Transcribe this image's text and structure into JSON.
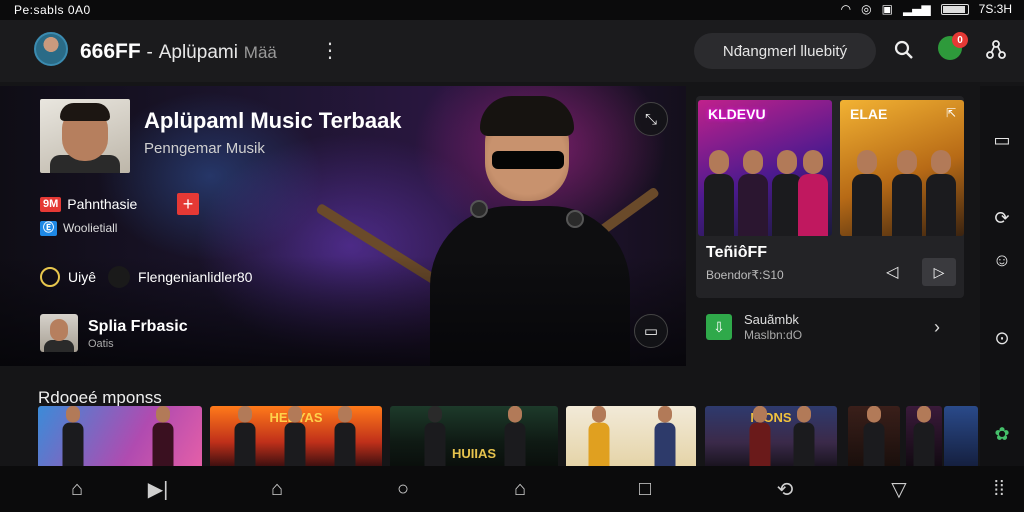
{
  "status_bar": {
    "left_text": "Pe:sabls 0A0",
    "time": "7S:3H"
  },
  "app_bar": {
    "brand": "666FF",
    "separator": "-",
    "app_name": "Aplüpami",
    "app_suffix": "Mää",
    "search_chip": "Nđangmerl lluebitý",
    "notification_count": "0"
  },
  "hero": {
    "title": "Aplüpaml Music Terbaak",
    "subtitle": "Penngemar Musik",
    "tag1": "9M",
    "tag1_text": "Pahnthasie",
    "tag2": "Ⓔ",
    "tag2_text": "Woolietiall",
    "meta_label": "Uiyê",
    "meta_text": "Flengenianlidler80",
    "artist_name": "Splia Frbasic",
    "artist_sub": "Oatis"
  },
  "right_panel": {
    "card1_title": "KLDEVU",
    "card2_title": "ELAE",
    "title": "TeñiôFF",
    "subtitle": "Boendor₹:S10",
    "download_title": "Sauãmbk",
    "download_sub": "Maslbn:dO"
  },
  "shelf": {
    "title": "Rdooeé mponss",
    "tiles": [
      {
        "title": ""
      },
      {
        "title": "HEDYAS"
      },
      {
        "title": "HUIIAS"
      },
      {
        "title": ""
      },
      {
        "title": "NIONS"
      },
      {
        "title": ""
      },
      {
        "title": ""
      }
    ]
  },
  "colors": {
    "accent_red": "#e53935",
    "accent_green": "#2fa94a",
    "background": "#151517"
  }
}
